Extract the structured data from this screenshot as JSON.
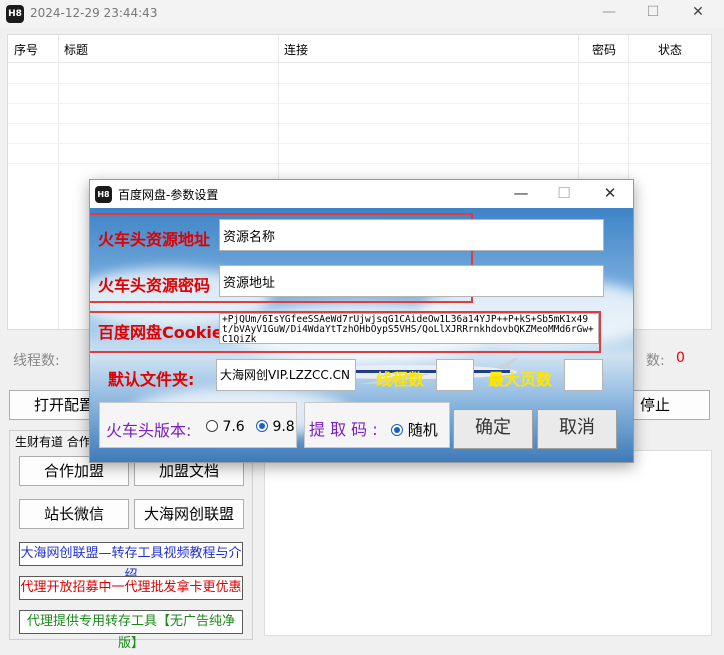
{
  "app": {
    "title": "2024-12-29 23:44:43",
    "icon_text": "H8"
  },
  "table": {
    "headers": {
      "index": "序号",
      "title": "标题",
      "link": "连接",
      "password": "密码",
      "status": "状态"
    }
  },
  "status": {
    "threads_label": "线程数:",
    "count_tail": "数:",
    "count_value": "0"
  },
  "buttons": {
    "open_config": "打开配置",
    "stop": "停止",
    "cooperate": "合作加盟",
    "join_doc": "加盟文档",
    "wechat": "站长微信",
    "alliance": "大海网创联盟"
  },
  "group": {
    "title": "生财有道 合作"
  },
  "links": {
    "video": "大海网创联盟—转存工具视频教程与介绍",
    "agent": "代理开放招募中一代理批发拿卡更优惠",
    "tool": "代理提供专用转存工具【无广告纯净版】"
  },
  "colors": {
    "link_video": "#1f2fd6",
    "link_agent": "#e00000",
    "link_tool": "#1a8a1a"
  },
  "dialog": {
    "title": "百度网盘-参数设置",
    "res_addr_label": "火车头资源地址",
    "res_addr_value": "资源名称",
    "res_pwd_label": "火车头资源密码",
    "res_pwd_value": "资源地址",
    "cookie_label": "百度网盘Cookie",
    "cookie_value": "+PjQUm/6IsYGfeeSSAeWd7rUjwjsqG1CAideOw1L36a14YJP++P+kS+Sb5mK1x49t/bVAyV1GuW/Di4WdaYtTzhOHbOypS5VHS/QoLlXJRRrnkhdovbQKZMeoMMd6rGw+C1QiZk",
    "folder_label": "默认文件夹:",
    "folder_value": "大海网创VIP.LZZCC.CN",
    "threads_label": "线程数",
    "maxpages_label": "最大页数",
    "version_label": "火车头版本:",
    "version_opt1": "7.6",
    "version_opt2": "9.8",
    "code_label": "提 取 码 :",
    "code_opt": "随机",
    "ok": "确定",
    "cancel": "取消"
  }
}
